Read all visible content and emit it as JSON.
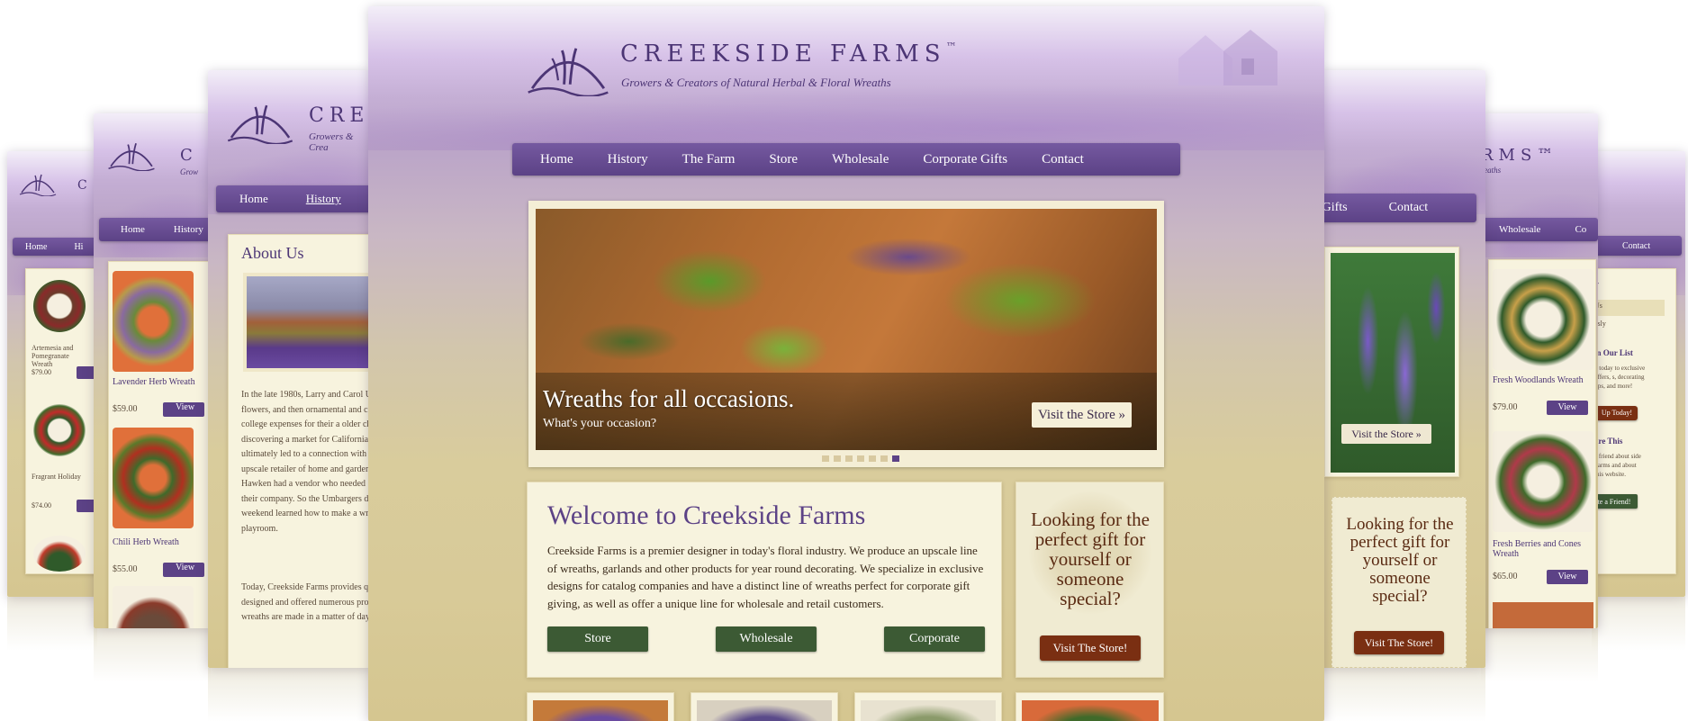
{
  "brand": {
    "name": "Creekside Farms",
    "tm": "™",
    "tagline": "Growers & Creators of Natural Herbal & Floral Wreaths"
  },
  "nav": {
    "items": [
      "Home",
      "History",
      "The Farm",
      "Store",
      "Wholesale",
      "Corporate Gifts",
      "Contact"
    ]
  },
  "hero": {
    "title": "Wreaths for all occasions.",
    "subtitle": "What's your occasion?",
    "cta": "Visit the Store »",
    "dots": 7,
    "active_dot": 7
  },
  "welcome": {
    "title": "Welcome to Creekside Farms",
    "body": "Creekside Farms is a premier designer in today's floral industry. We produce an upscale line of wreaths, garlands and other products for year round decorating. We specialize in exclusive designs for catalog companies and have a distinct line of wreaths perfect for corporate gift giving, as well as offer a unique line for wholesale and retail customers.",
    "buttons": [
      "Store",
      "Wholesale",
      "Corporate"
    ]
  },
  "gift": {
    "text": "Looking for the perfect gift for yourself or someone special?",
    "button": "Visit The Store!"
  },
  "about": {
    "title": "About Us",
    "p1": "In the late 1980s, Larry and Carol U flowers, and then ornamental and c college expenses for their a older ch discovering a market for California ultimately led to a connection with upscale retailer of home and garden Hawken had a vendor who needed their company. So the Umbargers d weekend learned how to make a wr playroom.",
    "p2": "Today, Creekside Farms provides q designed and offered numerous pro wreaths are made in a matter of day"
  },
  "store_left": {
    "items": [
      {
        "name": "Lavender Herb Wreath",
        "price": "$59.00",
        "btn": "View"
      },
      {
        "name": "Chili Herb Wreath",
        "price": "$55.00",
        "btn": "View"
      }
    ]
  },
  "store_far_left": {
    "items": [
      {
        "name": "Artemesia and Pomegranate Wreath",
        "price": "$79.00"
      },
      {
        "name": "Fragrant Holiday",
        "price": "$74.00"
      }
    ]
  },
  "store_right": {
    "items": [
      {
        "name": "Fresh Woodlands Wreath",
        "price": "$79.00",
        "btn": "View"
      },
      {
        "name": "Fresh Berries and Cones Wreath",
        "price": "$65.00",
        "btn": "View"
      }
    ]
  },
  "sidebar_far_right": {
    "heading_fragment": "y",
    "item1": "Us",
    "item2": "esly",
    "list_heading": "in Our List",
    "list_body": "n today to exclusive offers, s, decorating tips, and more!",
    "signup": "Up Today!",
    "share_heading": "are This",
    "share_body": "a friend about side Farms and about this website.",
    "share_btn": "te a Friend!",
    "contact": "Contact"
  },
  "right_card": {
    "cta": "Visit the Store »"
  },
  "colors": {
    "purple": "#5c4286",
    "brown": "#7a2f12",
    "green": "#3c5a34",
    "cream": "#f7f3de"
  }
}
